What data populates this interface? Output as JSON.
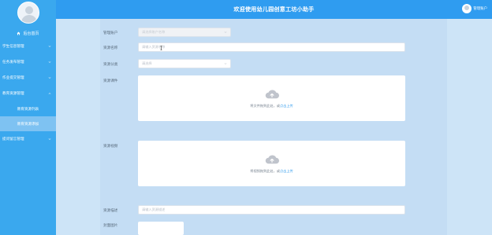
{
  "header": {
    "title": "欢迎使用幼儿园创意工坊小助手",
    "user_name": "管理账户"
  },
  "sidebar": {
    "home_label": "后台首页",
    "items": [
      {
        "label": "学生信息管理"
      },
      {
        "label": "任务发布管理"
      },
      {
        "label": "作业提交管理"
      },
      {
        "label": "教育资源管理"
      }
    ],
    "sub_items": [
      {
        "label": "教育资源列表"
      },
      {
        "label": "教育资源添加"
      }
    ],
    "last_item": {
      "label": "提问留言管理"
    }
  },
  "form": {
    "account_label": "管理账户",
    "account_placeholder": "请选择账户名称",
    "name_label": "资源名称",
    "name_placeholder": "请输入资源名称",
    "category_label": "资源分类",
    "category_placeholder": "请选择",
    "file_label": "资源课件",
    "file_hint": "将文件拖到此处，或",
    "file_link": "点击上传",
    "video_label": "资源视频",
    "video_hint": "将视频拖到此处，或",
    "video_link": "点击上传",
    "desc_label": "资源描述",
    "desc_placeholder": "请输入资源描述",
    "cover_label": "封面图片"
  },
  "colors": {
    "sidebar": "#3aa8ee",
    "header": "#2f9cf0",
    "accent": "#3aa0ee"
  }
}
